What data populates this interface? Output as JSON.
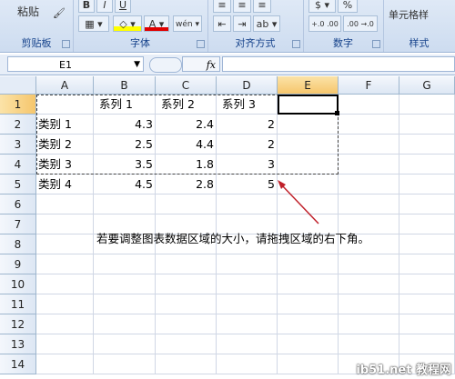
{
  "ribbon": {
    "clipboard": {
      "label": "剪贴板",
      "paste": "粘贴"
    },
    "font": {
      "label": "字体",
      "bold": "B",
      "italic": "I",
      "underline": "U"
    },
    "alignment": {
      "label": "对齐方式"
    },
    "number": {
      "label": "数字",
      "percent": "%",
      "decimal_inc": "+.0 .00",
      "decimal_dec": ".00 →.0"
    },
    "styles": {
      "label": "样式",
      "cell_styles": "单元格样"
    }
  },
  "formula_bar": {
    "name_box": "E1",
    "fx": "fx",
    "value": ""
  },
  "columns": [
    "A",
    "B",
    "C",
    "D",
    "E",
    "F",
    "G"
  ],
  "rows": [
    "1",
    "2",
    "3",
    "4",
    "5",
    "6",
    "7",
    "8",
    "9",
    "10",
    "11",
    "12",
    "13",
    "14"
  ],
  "cells": {
    "B1": "系列 1",
    "C1": "系列 2",
    "D1": "系列 3",
    "A2": "类别 1",
    "B2": "4.3",
    "C2": "2.4",
    "D2": "2",
    "A3": "类别 2",
    "B3": "2.5",
    "C3": "4.4",
    "D3": "2",
    "A4": "类别 3",
    "B4": "3.5",
    "C4": "1.8",
    "D4": "3",
    "A5": "类别 4",
    "B5": "4.5",
    "C5": "2.8",
    "D5": "5"
  },
  "note": "若要调整图表数据区域的大小，请拖拽区域的右下角。",
  "watermark": "ib51.net 教程网",
  "colors": {
    "arrow": "#c0202a",
    "selection": "#f6c66c"
  }
}
